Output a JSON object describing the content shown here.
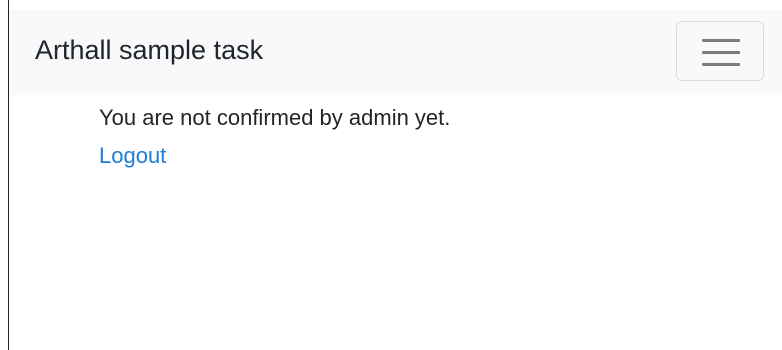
{
  "navbar": {
    "brand": "Arthall sample task",
    "toggler_icon": "hamburger-menu-icon"
  },
  "main": {
    "message": "You are not confirmed by admin yet.",
    "logout_label": "Logout"
  },
  "colors": {
    "navbar_bg": "#f8f9fa",
    "link": "#1e7bd8",
    "text": "#212529"
  }
}
